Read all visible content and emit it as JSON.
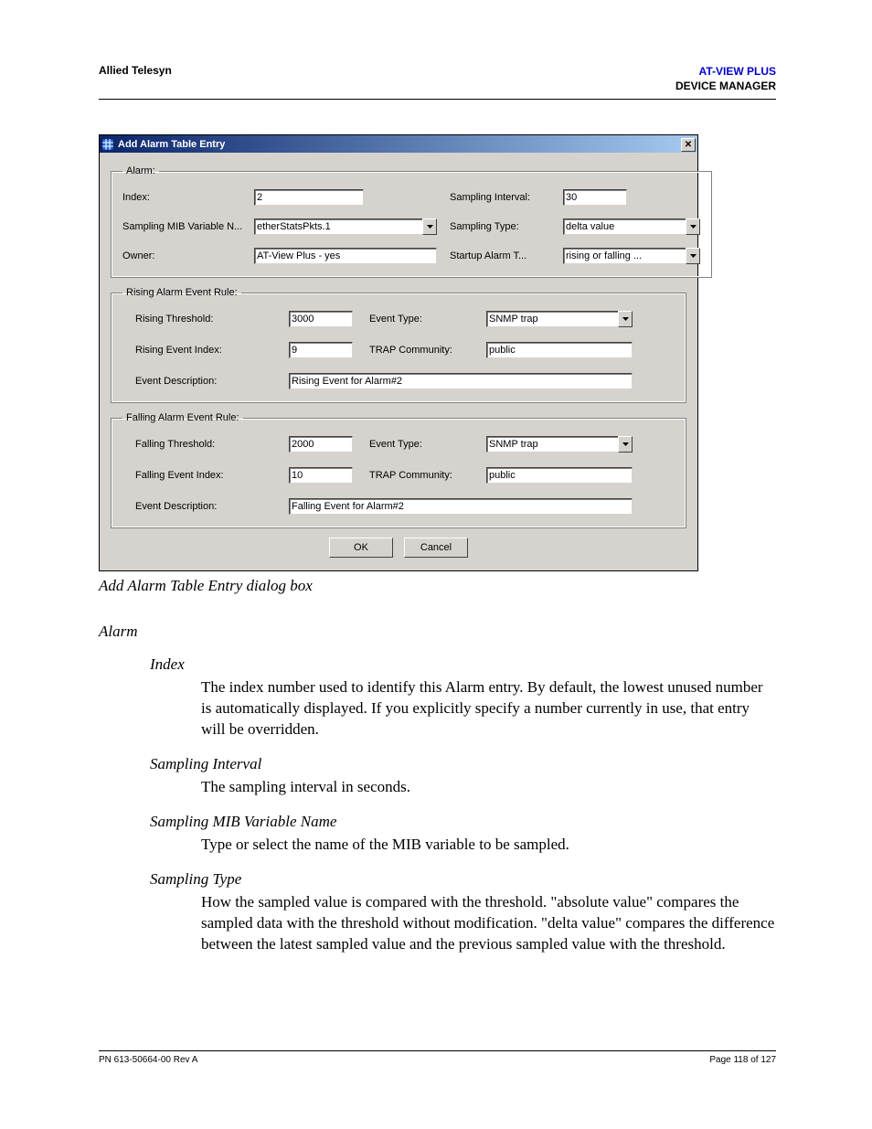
{
  "header": {
    "left": "Allied Telesyn",
    "right_line1": "AT-VIEW PLUS",
    "right_line2": "DEVICE MANAGER"
  },
  "dialog": {
    "title": "Add Alarm Table Entry",
    "close_glyph": "✕",
    "alarm": {
      "legend": "Alarm:",
      "index_label": "Index:",
      "index_value": "2",
      "sampling_interval_label": "Sampling Interval:",
      "sampling_interval_value": "30",
      "mib_var_label": "Sampling MIB Variable N...",
      "mib_var_value": "etherStatsPkts.1",
      "sampling_type_label": "Sampling Type:",
      "sampling_type_value": "delta value",
      "owner_label": "Owner:",
      "owner_value": "AT-View Plus - yes",
      "startup_alarm_label": "Startup Alarm T...",
      "startup_alarm_value": "rising or falling ..."
    },
    "rising": {
      "legend": "Rising Alarm Event Rule:",
      "threshold_label": "Rising Threshold:",
      "threshold_value": "3000",
      "event_type_label": "Event Type:",
      "event_type_value": "SNMP trap",
      "event_index_label": "Rising Event Index:",
      "event_index_value": "9",
      "trap_comm_label": "TRAP Community:",
      "trap_comm_value": "public",
      "desc_label": "Event Description:",
      "desc_value": "Rising Event for Alarm#2"
    },
    "falling": {
      "legend": "Falling Alarm Event Rule:",
      "threshold_label": "Falling Threshold:",
      "threshold_value": "2000",
      "event_type_label": "Event Type:",
      "event_type_value": "SNMP trap",
      "event_index_label": "Falling Event Index:",
      "event_index_value": "10",
      "trap_comm_label": "TRAP Community:",
      "trap_comm_value": "public",
      "desc_label": "Event Description:",
      "desc_value": "Falling Event for Alarm#2"
    },
    "buttons": {
      "ok": "OK",
      "cancel": "Cancel"
    }
  },
  "caption": "Add Alarm Table Entry dialog box",
  "section_heading": "Alarm",
  "definitions": [
    {
      "term": "Index",
      "body": "The index number used to identify this Alarm entry. By default, the lowest unused number is automatically displayed. If you explicitly specify a number currently in use, that entry will be overridden."
    },
    {
      "term": "Sampling Interval",
      "body": "The sampling interval in seconds."
    },
    {
      "term": "Sampling MIB Variable Name",
      "body": "Type or select the name of the MIB variable to be sampled."
    },
    {
      "term": "Sampling Type",
      "body": "How the sampled value is compared with the threshold. \"absolute value\" compares the sampled data with the threshold without modification. \"delta value\" compares the difference between the latest sampled value and the previous sampled value with the threshold."
    }
  ],
  "footer": {
    "left": "PN 613-50664-00 Rev A",
    "right": "Page 118 of 127"
  }
}
